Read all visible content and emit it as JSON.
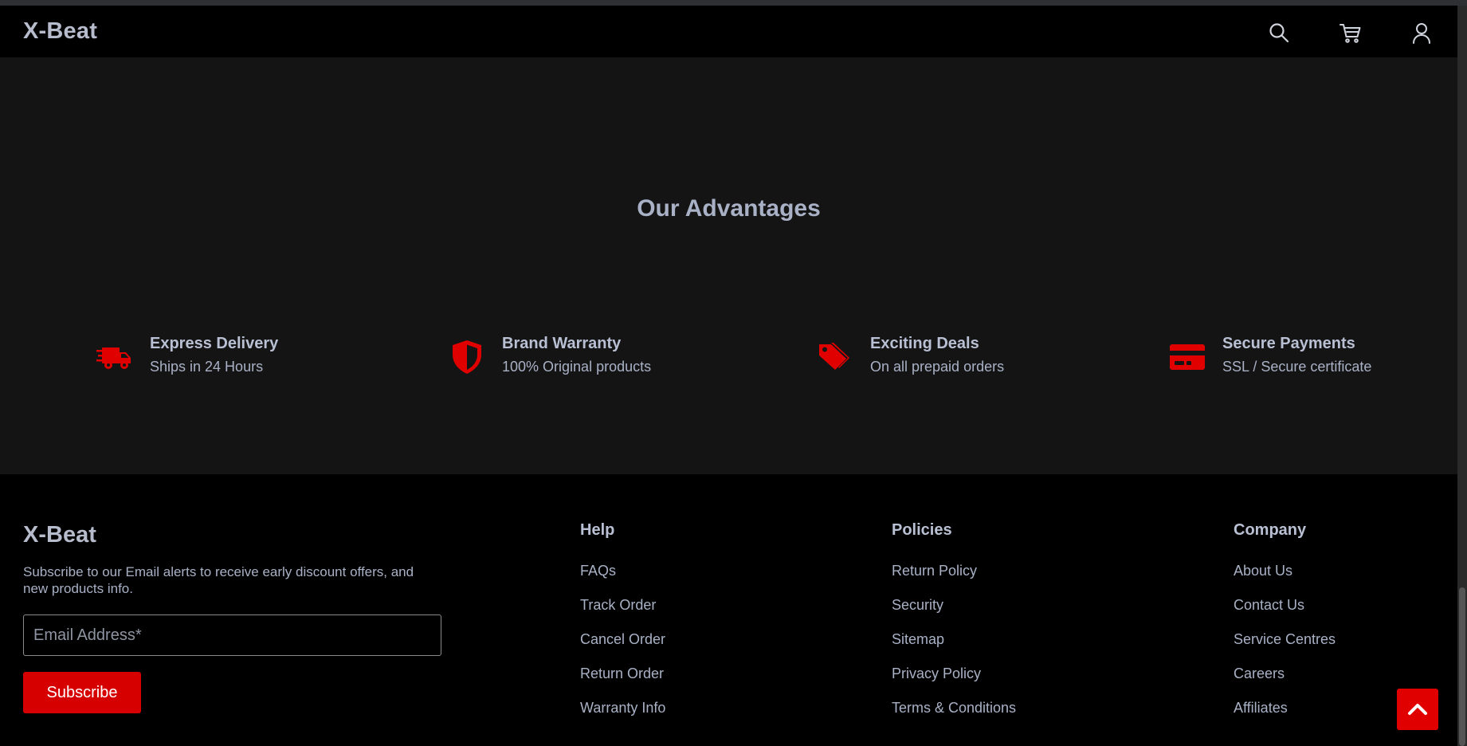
{
  "header": {
    "logo": "X-Beat",
    "icons": [
      "search-icon",
      "cart-icon",
      "user-icon"
    ]
  },
  "advantages": {
    "title": "Our Advantages",
    "items": [
      {
        "icon": "delivery-truck-icon",
        "name": "Express Delivery",
        "desc": "Ships in 24 Hours"
      },
      {
        "icon": "shield-icon",
        "name": "Brand Warranty",
        "desc": "100% Original products"
      },
      {
        "icon": "tags-icon",
        "name": "Exciting Deals",
        "desc": "On all prepaid orders"
      },
      {
        "icon": "credit-card-icon",
        "name": "Secure Payments",
        "desc": "SSL / Secure certificate"
      }
    ]
  },
  "footer": {
    "logo": "X-Beat",
    "text": "Subscribe to our Email alerts to receive early discount offers, and new products info.",
    "email_placeholder": "Email Address*",
    "subscribe_label": "Subscribe",
    "columns": [
      {
        "title": "Help",
        "links": [
          "FAQs",
          "Track Order",
          "Cancel Order",
          "Return Order",
          "Warranty Info"
        ]
      },
      {
        "title": "Policies",
        "links": [
          "Return Policy",
          "Security",
          "Sitemap",
          "Privacy Policy",
          "Terms & Conditions"
        ]
      },
      {
        "title": "Company",
        "links": [
          "About Us",
          "Contact Us",
          "Service Centres",
          "Careers",
          "Affiliates"
        ]
      }
    ]
  },
  "colors": {
    "accent": "#e10000",
    "bg_dark": "#141414",
    "text": "#a9b1c6"
  }
}
